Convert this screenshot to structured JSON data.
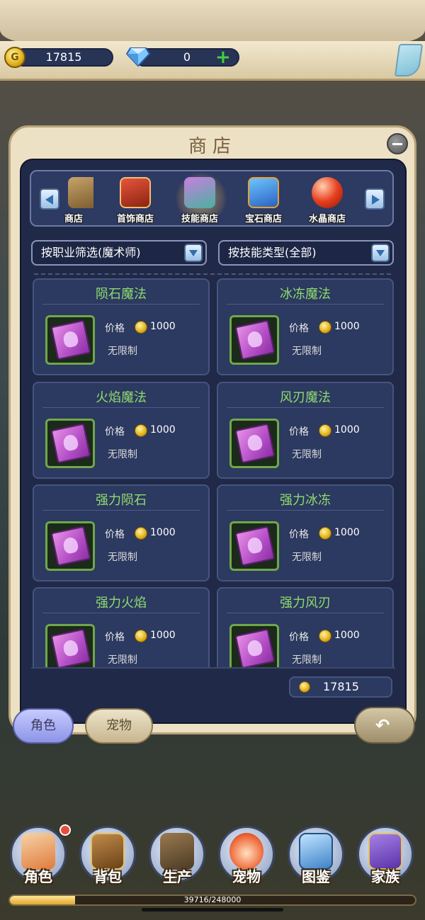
{
  "currency": {
    "gold": "17815",
    "gems": "0",
    "gold_icon_glyph": "G"
  },
  "shop": {
    "title": "商店",
    "categories": [
      {
        "label": "商店",
        "icon": "pet-shop-icon",
        "partial": true
      },
      {
        "label": "首饰商店",
        "icon": "jewelry-shop-icon"
      },
      {
        "label": "技能商店",
        "icon": "skill-shop-icon",
        "active": true
      },
      {
        "label": "宝石商店",
        "icon": "gem-shop-icon"
      },
      {
        "label": "水晶商店",
        "icon": "crystal-shop-icon"
      }
    ],
    "filters": {
      "class_filter": "按职业筛选(魔术师)",
      "skill_filter": "按技能类型(全部)"
    },
    "price_label": "价格",
    "items": [
      {
        "name": "陨石魔法",
        "price": "1000",
        "limit": "无限制"
      },
      {
        "name": "冰冻魔法",
        "price": "1000",
        "limit": "无限制"
      },
      {
        "name": "火焰魔法",
        "price": "1000",
        "limit": "无限制"
      },
      {
        "name": "风刃魔法",
        "price": "1000",
        "limit": "无限制"
      },
      {
        "name": "强力陨石",
        "price": "1000",
        "limit": "无限制"
      },
      {
        "name": "强力冰冻",
        "price": "1000",
        "limit": "无限制"
      },
      {
        "name": "强力火焰",
        "price": "1000",
        "limit": "无限制"
      },
      {
        "name": "强力风刃",
        "price": "1000",
        "limit": "无限制"
      }
    ],
    "total_gold": "17815"
  },
  "tabs": {
    "role": "角色",
    "pet": "宠物"
  },
  "bottom_nav": [
    {
      "label": "角色",
      "icon": "character-icon",
      "badge": true
    },
    {
      "label": "背包",
      "icon": "backpack-icon"
    },
    {
      "label": "生产",
      "icon": "production-icon"
    },
    {
      "label": "宠物",
      "icon": "pet-icon"
    },
    {
      "label": "图鉴",
      "icon": "codex-icon"
    },
    {
      "label": "家族",
      "icon": "family-icon"
    }
  ],
  "experience": {
    "text": "39716/248000",
    "current": 39716,
    "max": 248000
  },
  "colors": {
    "item_name": "#8fdc6e",
    "panel": "#202a48",
    "frame": "#ece1c4"
  }
}
